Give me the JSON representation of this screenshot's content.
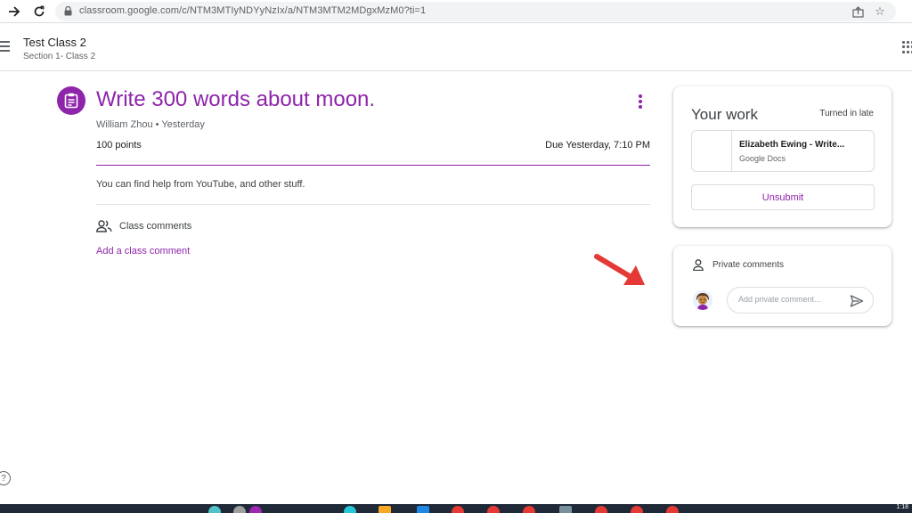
{
  "browser": {
    "url": "classroom.google.com/c/NTM3MTIyNDYyNzIx/a/NTM3MTM2MDgxMzM0?ti=1"
  },
  "header": {
    "class_name": "Test Class 2",
    "section": "Section 1- Class 2"
  },
  "assignment": {
    "title": "Write 300 words about moon.",
    "author_line": "William Zhou • Yesterday",
    "points": "100 points",
    "due": "Due Yesterday, 7:10 PM",
    "description": "You can find help from YouTube, and other stuff.",
    "class_comments_label": "Class comments",
    "add_class_comment": "Add a class comment"
  },
  "your_work": {
    "title": "Your work",
    "status": "Turned in late",
    "attachment_name": "Elizabeth Ewing - Write...",
    "attachment_type": "Google Docs",
    "unsubmit_label": "Unsubmit"
  },
  "private_comments": {
    "label": "Private comments",
    "placeholder": "Add private comment..."
  },
  "taskbar": {
    "clock": "1:18"
  },
  "colors": {
    "accent": "#8e24aa",
    "annotation_arrow": "#e53935"
  },
  "icons": [
    "back-arrow-icon",
    "reload-icon",
    "lock-icon",
    "share-icon",
    "star-icon",
    "menu-icon",
    "apps-grid-icon",
    "assignment-icon",
    "more-vert-icon",
    "people-icon",
    "person-icon",
    "send-icon",
    "help-icon"
  ]
}
